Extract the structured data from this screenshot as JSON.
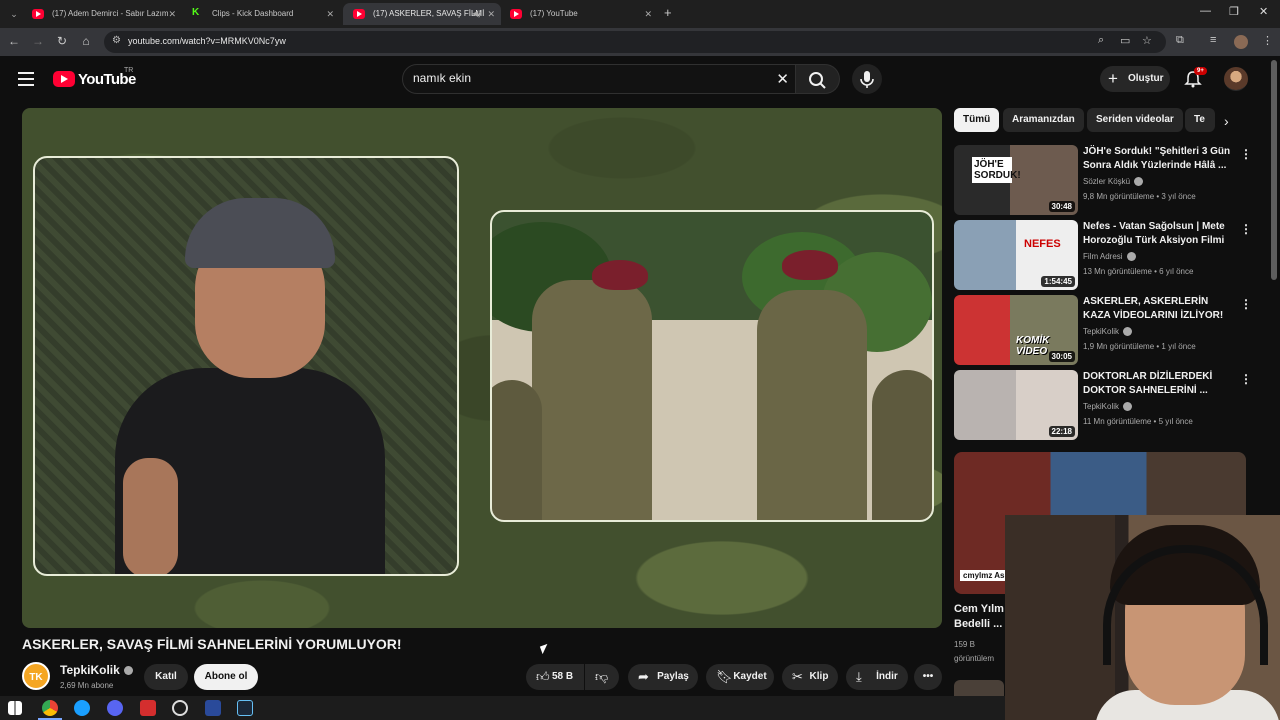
{
  "browser": {
    "tabs": [
      {
        "label": "(17) Adem Demirci - Sabır Lazım",
        "icon": "youtube-favicon"
      },
      {
        "label": "Clips - Kick Dashboard",
        "icon": "kick-favicon"
      },
      {
        "label": "(17) ASKERLER, SAVAŞ FİLMİ",
        "icon": "youtube-favicon",
        "active": true
      },
      {
        "label": "(17) YouTube",
        "icon": "youtube-favicon"
      }
    ],
    "url": "youtube.com/watch?v=MRMKV0Nc7yw"
  },
  "header": {
    "logo_text": "YouTube",
    "country_code": "TR",
    "search_value": "namık ekin",
    "create_label": "Oluştur",
    "notification_count": "9+"
  },
  "video": {
    "title": "ASKERLER, SAVAŞ FİLMİ SAHNELERİNİ YORUMLUYOR!",
    "channel": {
      "name": "TepkiKolik",
      "avatar_text": "TK",
      "subscribers": "2,69 Mn abone"
    },
    "join_label": "Katıl",
    "subscribe_label": "Abone ol",
    "likes": "58 B",
    "share_label": "Paylaş",
    "save_label": "Kaydet",
    "clip_label": "Klip",
    "download_label": "İndir"
  },
  "chips": [
    "Tümü",
    "Aramanızdan",
    "Seriden videolar",
    "Te"
  ],
  "recommendations": [
    {
      "title": "JÖH'e Sorduk! \"Şehitleri 3 Gün Sonra Aldık Yüzlerinde Hâlâ ...",
      "channel": "Sözler Köşkü",
      "meta": "9,8 Mn görüntüleme • 3 yıl önce",
      "duration": "30:48",
      "overlay": "JÖH'E SORDUK!"
    },
    {
      "title": "Nefes - Vatan Sağolsun | Mete Horozoğlu Türk Aksiyon Filmi",
      "channel": "Film Adresi",
      "meta": "13 Mn görüntüleme • 6 yıl önce",
      "duration": "1:54:45",
      "overlay": "NEFES"
    },
    {
      "title": "ASKERLER, ASKERLERİN KAZA VİDEOLARINI İZLİYOR!",
      "channel": "TepkiKolik",
      "meta": "1,9 Mn görüntüleme • 1 yıl önce",
      "duration": "30:05",
      "overlay": "KOMİK VİDEO"
    },
    {
      "title": "DOKTORLAR DİZİLERDEKİ DOKTOR SAHNELERİNİ ...",
      "channel": "TepkiKolik",
      "meta": "11 Mn görüntüleme • 5 yıl önce",
      "duration": "22:18",
      "overlay": ""
    }
  ],
  "partial_recommendation": {
    "title_line1": "Cem Yılm",
    "title_line2": "Bedelli ...",
    "views": "159 B",
    "meta": "görüntülem",
    "overlay": "cmylmz Ask"
  }
}
